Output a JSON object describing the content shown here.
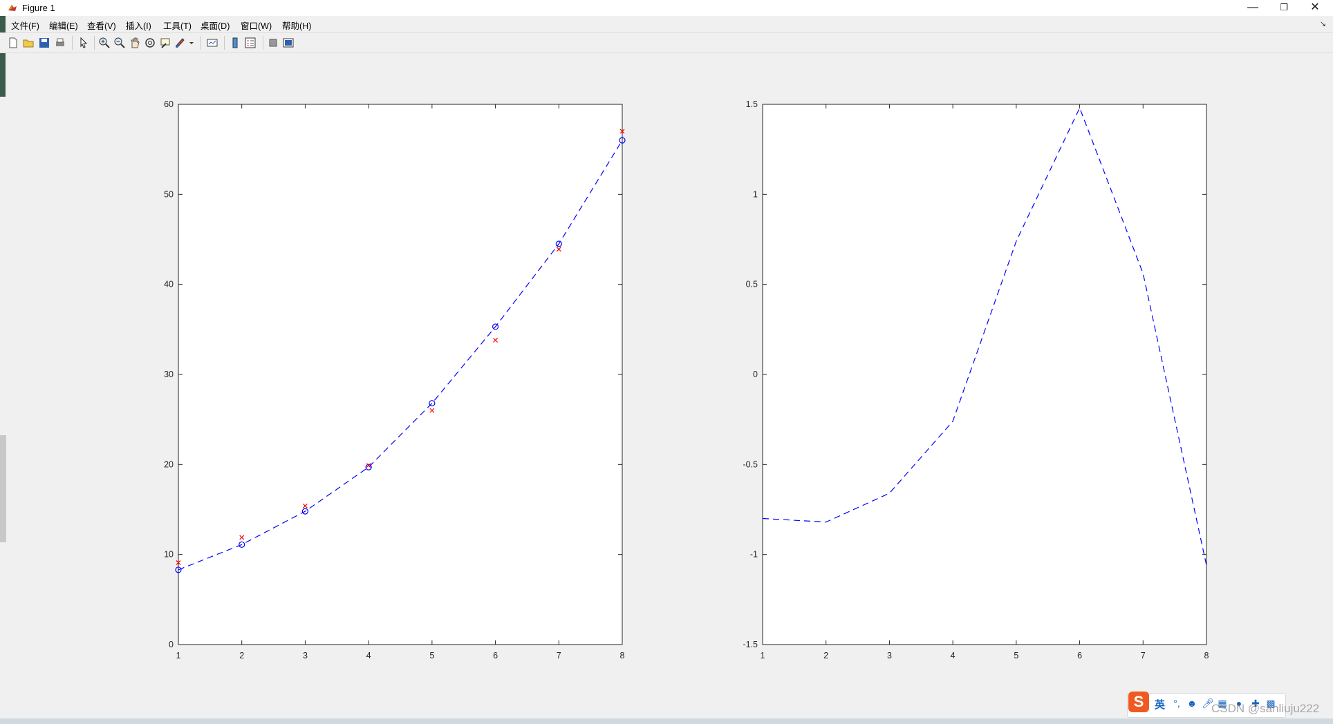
{
  "window": {
    "title": "Figure 1",
    "controls": {
      "minimize": "—",
      "maximize": "❐",
      "close": "✕"
    }
  },
  "menu": {
    "items": [
      "文件(F)",
      "编辑(E)",
      "查看(V)",
      "插入(I)",
      "工具(T)",
      "桌面(D)",
      "窗口(W)",
      "帮助(H)"
    ],
    "overflow_arrow": "↘"
  },
  "toolbar": {
    "icons": [
      "new-figure-icon",
      "open-file-icon",
      "save-icon",
      "print-icon",
      "edit-plot-arrow-icon",
      "zoom-in-icon",
      "zoom-out-icon",
      "pan-hand-icon",
      "rotate-3d-icon",
      "data-cursor-icon",
      "brush-icon",
      "brush-dropdown-icon",
      "link-plot-icon",
      "insert-colorbar-icon",
      "insert-legend-icon",
      "hide-plot-tools-icon",
      "show-plot-tools-icon"
    ]
  },
  "colors": {
    "fit_line": "#0000ff",
    "fit_marker": "#0000ff",
    "data_marker": "#ff0000",
    "axes_bg": "#ffffff",
    "figure_bg": "#f0f0f0"
  },
  "chart_data": [
    {
      "type": "line",
      "title": "",
      "xlabel": "",
      "ylabel": "",
      "xlim": [
        1,
        8
      ],
      "ylim": [
        0,
        60
      ],
      "xticks": [
        "1",
        "2",
        "3",
        "4",
        "5",
        "6",
        "7",
        "8"
      ],
      "yticks": [
        "0",
        "10",
        "20",
        "30",
        "40",
        "50",
        "60"
      ],
      "grid": false,
      "series": [
        {
          "style": "blue dashed line with circle markers",
          "x": [
            1,
            2,
            3,
            4,
            5,
            6,
            7,
            8
          ],
          "y": [
            8.3,
            11.1,
            14.8,
            19.7,
            26.8,
            35.3,
            44.5,
            56.0
          ]
        },
        {
          "style": "red x markers",
          "x": [
            1,
            2,
            3,
            4,
            5,
            6,
            7,
            8
          ],
          "y": [
            9.1,
            11.9,
            15.4,
            19.9,
            26.0,
            33.8,
            43.9,
            57.0
          ]
        }
      ]
    },
    {
      "type": "line",
      "title": "",
      "xlabel": "",
      "ylabel": "",
      "xlim": [
        1,
        8
      ],
      "ylim": [
        -1.5,
        1.5
      ],
      "xticks": [
        "1",
        "2",
        "3",
        "4",
        "5",
        "6",
        "7",
        "8"
      ],
      "yticks": [
        "-1.5",
        "-1",
        "-0.5",
        "0",
        "0.5",
        "1",
        "1.5"
      ],
      "grid": false,
      "series": [
        {
          "style": "blue dashed line",
          "x": [
            1,
            2,
            3,
            4,
            5,
            6,
            7,
            8
          ],
          "y": [
            -0.8,
            -0.82,
            -0.66,
            -0.26,
            0.74,
            1.48,
            0.56,
            -1.06
          ]
        }
      ]
    }
  ],
  "ime": {
    "logo": "S",
    "mode": "英",
    "icons": [
      "punctuation-icon",
      "emoji-icon",
      "microphone-icon",
      "keyboard-icon",
      "user-icon",
      "skin-icon",
      "toolbox-icon"
    ]
  },
  "watermark": "CSDN @sanliuju222"
}
